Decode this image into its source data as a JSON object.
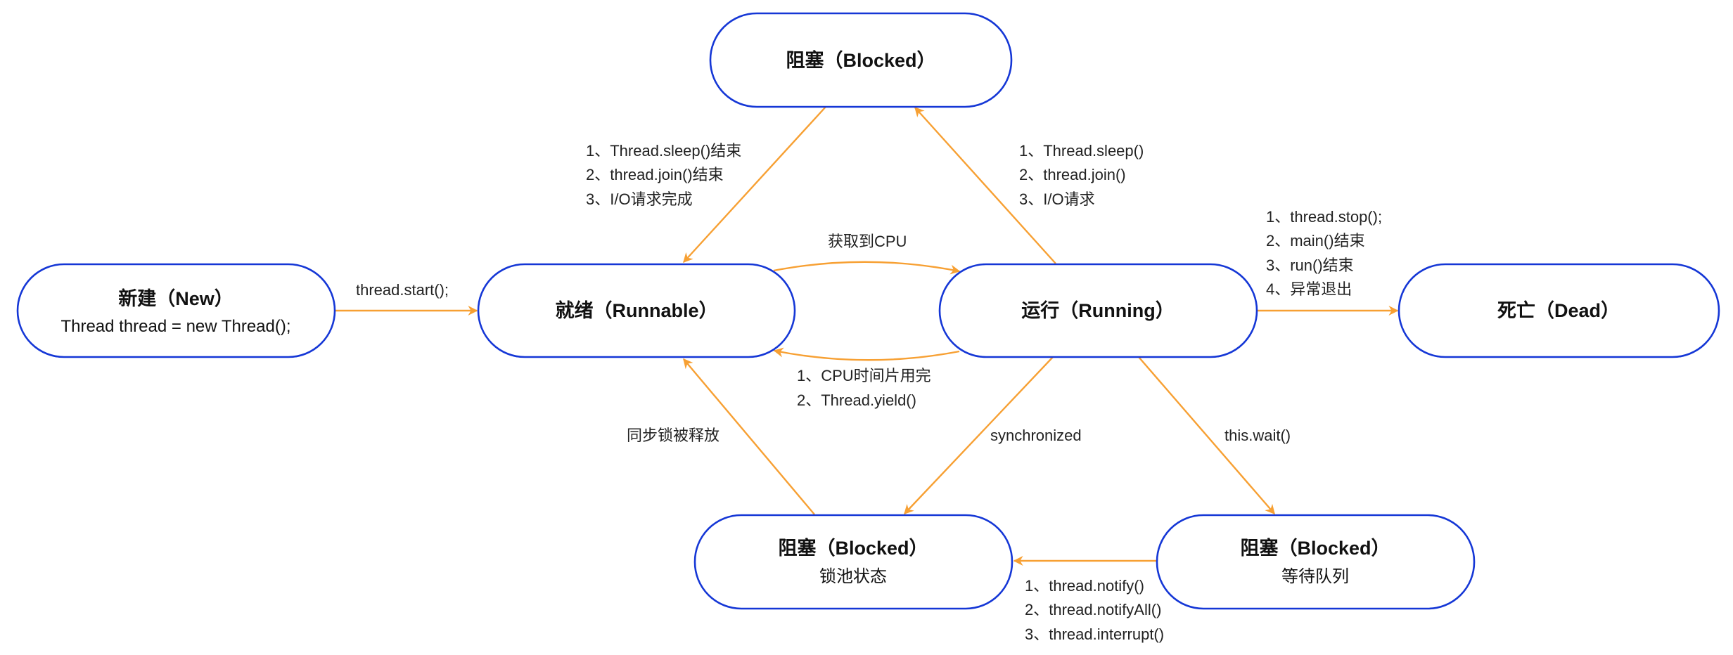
{
  "colors": {
    "node_border": "#1537d6",
    "arrow": "#f7a033",
    "text": "#111111"
  },
  "nodes": {
    "blocked_top": {
      "title": "阻塞（Blocked）"
    },
    "new": {
      "title": "新建（New）",
      "subtitle": "Thread thread = new Thread();"
    },
    "runnable": {
      "title": "就绪（Runnable）"
    },
    "running": {
      "title": "运行（Running）"
    },
    "dead": {
      "title": "死亡（Dead）"
    },
    "blocked_lock": {
      "title": "阻塞（Blocked）",
      "subtitle": "锁池状态"
    },
    "blocked_wait": {
      "title": "阻塞（Blocked）",
      "subtitle": "等待队列"
    }
  },
  "edges": {
    "new_to_runnable": [
      "thread.start();"
    ],
    "blocked_to_runnable": [
      "1、Thread.sleep()结束",
      "2、thread.join()结束",
      "3、I/O请求完成"
    ],
    "running_to_blocked": [
      "1、Thread.sleep()",
      "2、thread.join()",
      "3、I/O请求"
    ],
    "runnable_to_running": [
      "获取到CPU"
    ],
    "running_to_runnable": [
      "1、CPU时间片用完",
      "2、Thread.yield()"
    ],
    "running_to_dead": [
      "1、thread.stop();",
      "2、main()结束",
      "3、run()结束",
      "4、异常退出"
    ],
    "lock_to_runnable": [
      "同步锁被释放"
    ],
    "running_to_lock": [
      "synchronized"
    ],
    "running_to_wait": [
      "this.wait()"
    ],
    "wait_to_lock": [
      "1、thread.notify()",
      "2、thread.notifyAll()",
      "3、thread.interrupt()"
    ]
  }
}
